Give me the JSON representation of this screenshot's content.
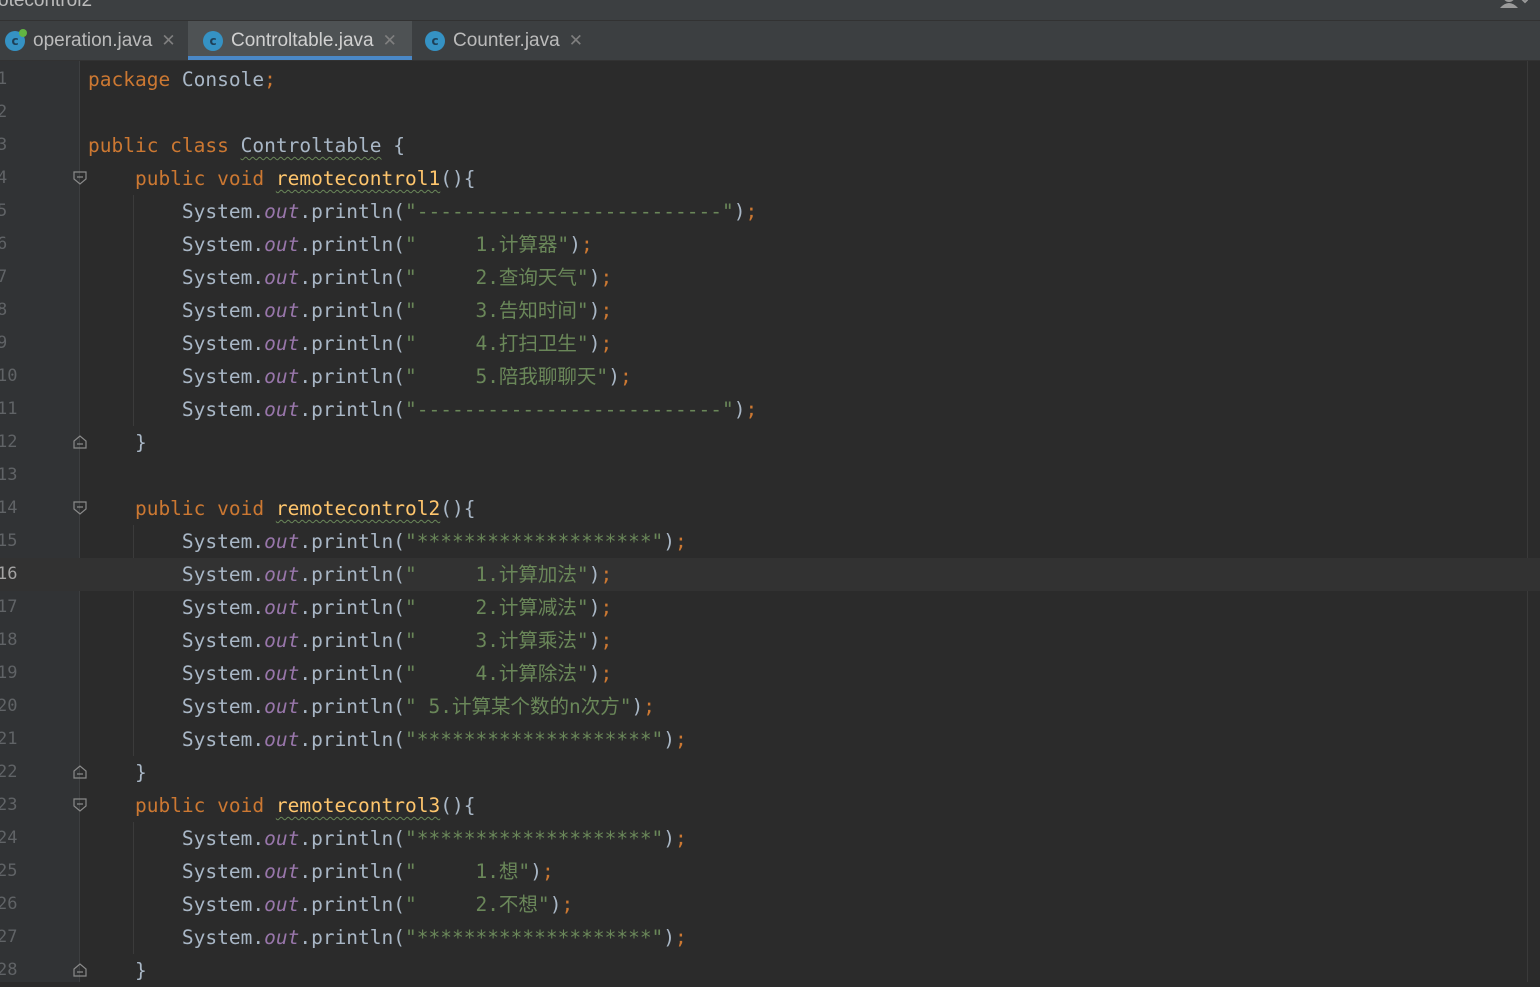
{
  "window": {
    "title": "otecontrol2"
  },
  "tabs": [
    {
      "label": "operation.java",
      "icon": "java-class-icon",
      "active": false
    },
    {
      "label": "Controltable.java",
      "icon": "java-class-icon",
      "active": true
    },
    {
      "label": "Counter.java",
      "icon": "java-class-icon",
      "active": false
    }
  ],
  "editor": {
    "current_line": 16,
    "line_numbers": [
      "1",
      "2",
      "3",
      "4",
      "5",
      "6",
      "7",
      "8",
      "9",
      "10",
      "11",
      "12",
      "13",
      "14",
      "15",
      "16",
      "17",
      "18",
      "19",
      "20",
      "21",
      "22",
      "23",
      "24",
      "25",
      "26",
      "27",
      "28"
    ],
    "lines": [
      {
        "n": "1",
        "tokens": [
          {
            "t": "package",
            "c": "kw"
          },
          {
            "t": " Console",
            "c": "pl"
          },
          {
            "t": ";",
            "c": "semi"
          }
        ]
      },
      {
        "n": "2",
        "tokens": []
      },
      {
        "n": "3",
        "tokens": [
          {
            "t": "public class ",
            "c": "kw"
          },
          {
            "t": "Controltable",
            "c": "cls"
          },
          {
            "t": " {",
            "c": "pl"
          }
        ]
      },
      {
        "n": "4",
        "fold": "open",
        "tokens": [
          {
            "t": "    public void ",
            "c": "kw"
          },
          {
            "t": "remotecontrol1",
            "c": "meth"
          },
          {
            "t": "(){",
            "c": "pl"
          }
        ]
      },
      {
        "n": "5",
        "tokens": [
          {
            "t": "        System.",
            "c": "pl"
          },
          {
            "t": "out",
            "c": "fld"
          },
          {
            "t": ".println(",
            "c": "pl"
          },
          {
            "t": "\"--------------------------\"",
            "c": "str"
          },
          {
            "t": ")",
            "c": "pl"
          },
          {
            "t": ";",
            "c": "semi"
          }
        ]
      },
      {
        "n": "6",
        "tokens": [
          {
            "t": "        System.",
            "c": "pl"
          },
          {
            "t": "out",
            "c": "fld"
          },
          {
            "t": ".println(",
            "c": "pl"
          },
          {
            "t": "\"     1.计算器\"",
            "c": "str"
          },
          {
            "t": ")",
            "c": "pl"
          },
          {
            "t": ";",
            "c": "semi"
          }
        ]
      },
      {
        "n": "7",
        "tokens": [
          {
            "t": "        System.",
            "c": "pl"
          },
          {
            "t": "out",
            "c": "fld"
          },
          {
            "t": ".println(",
            "c": "pl"
          },
          {
            "t": "\"     2.查询天气\"",
            "c": "str"
          },
          {
            "t": ")",
            "c": "pl"
          },
          {
            "t": ";",
            "c": "semi"
          }
        ]
      },
      {
        "n": "8",
        "tokens": [
          {
            "t": "        System.",
            "c": "pl"
          },
          {
            "t": "out",
            "c": "fld"
          },
          {
            "t": ".println(",
            "c": "pl"
          },
          {
            "t": "\"     3.告知时间\"",
            "c": "str"
          },
          {
            "t": ")",
            "c": "pl"
          },
          {
            "t": ";",
            "c": "semi"
          }
        ]
      },
      {
        "n": "9",
        "tokens": [
          {
            "t": "        System.",
            "c": "pl"
          },
          {
            "t": "out",
            "c": "fld"
          },
          {
            "t": ".println(",
            "c": "pl"
          },
          {
            "t": "\"     4.打扫卫生\"",
            "c": "str"
          },
          {
            "t": ")",
            "c": "pl"
          },
          {
            "t": ";",
            "c": "semi"
          }
        ]
      },
      {
        "n": "10",
        "tokens": [
          {
            "t": "        System.",
            "c": "pl"
          },
          {
            "t": "out",
            "c": "fld"
          },
          {
            "t": ".println(",
            "c": "pl"
          },
          {
            "t": "\"     5.陪我聊聊天\"",
            "c": "str"
          },
          {
            "t": ")",
            "c": "pl"
          },
          {
            "t": ";",
            "c": "semi"
          }
        ]
      },
      {
        "n": "11",
        "tokens": [
          {
            "t": "        System.",
            "c": "pl"
          },
          {
            "t": "out",
            "c": "fld"
          },
          {
            "t": ".println(",
            "c": "pl"
          },
          {
            "t": "\"--------------------------\"",
            "c": "str"
          },
          {
            "t": ")",
            "c": "pl"
          },
          {
            "t": ";",
            "c": "semi"
          }
        ]
      },
      {
        "n": "12",
        "fold": "close",
        "tokens": [
          {
            "t": "    }",
            "c": "pl"
          }
        ]
      },
      {
        "n": "13",
        "tokens": []
      },
      {
        "n": "14",
        "fold": "open",
        "tokens": [
          {
            "t": "    public void ",
            "c": "kw"
          },
          {
            "t": "remotecontrol2",
            "c": "meth"
          },
          {
            "t": "(){",
            "c": "pl"
          }
        ]
      },
      {
        "n": "15",
        "tokens": [
          {
            "t": "        System.",
            "c": "pl"
          },
          {
            "t": "out",
            "c": "fld"
          },
          {
            "t": ".println(",
            "c": "pl"
          },
          {
            "t": "\"********************\"",
            "c": "str"
          },
          {
            "t": ")",
            "c": "pl"
          },
          {
            "t": ";",
            "c": "semi"
          }
        ]
      },
      {
        "n": "16",
        "tokens": [
          {
            "t": "        System.",
            "c": "pl"
          },
          {
            "t": "out",
            "c": "fld"
          },
          {
            "t": ".println(",
            "c": "pl"
          },
          {
            "t": "\"     1.计算加法\"",
            "c": "str"
          },
          {
            "t": ")",
            "c": "pl"
          },
          {
            "t": ";",
            "c": "semi"
          }
        ]
      },
      {
        "n": "17",
        "tokens": [
          {
            "t": "        System.",
            "c": "pl"
          },
          {
            "t": "out",
            "c": "fld"
          },
          {
            "t": ".println(",
            "c": "pl"
          },
          {
            "t": "\"     2.计算减法\"",
            "c": "str"
          },
          {
            "t": ")",
            "c": "pl"
          },
          {
            "t": ";",
            "c": "semi"
          }
        ]
      },
      {
        "n": "18",
        "tokens": [
          {
            "t": "        System.",
            "c": "pl"
          },
          {
            "t": "out",
            "c": "fld"
          },
          {
            "t": ".println(",
            "c": "pl"
          },
          {
            "t": "\"     3.计算乘法\"",
            "c": "str"
          },
          {
            "t": ")",
            "c": "pl"
          },
          {
            "t": ";",
            "c": "semi"
          }
        ]
      },
      {
        "n": "19",
        "tokens": [
          {
            "t": "        System.",
            "c": "pl"
          },
          {
            "t": "out",
            "c": "fld"
          },
          {
            "t": ".println(",
            "c": "pl"
          },
          {
            "t": "\"     4.计算除法\"",
            "c": "str"
          },
          {
            "t": ")",
            "c": "pl"
          },
          {
            "t": ";",
            "c": "semi"
          }
        ]
      },
      {
        "n": "20",
        "tokens": [
          {
            "t": "        System.",
            "c": "pl"
          },
          {
            "t": "out",
            "c": "fld"
          },
          {
            "t": ".println(",
            "c": "pl"
          },
          {
            "t": "\" 5.计算某个数的n次方\"",
            "c": "str"
          },
          {
            "t": ")",
            "c": "pl"
          },
          {
            "t": ";",
            "c": "semi"
          }
        ]
      },
      {
        "n": "21",
        "tokens": [
          {
            "t": "        System.",
            "c": "pl"
          },
          {
            "t": "out",
            "c": "fld"
          },
          {
            "t": ".println(",
            "c": "pl"
          },
          {
            "t": "\"********************\"",
            "c": "str"
          },
          {
            "t": ")",
            "c": "pl"
          },
          {
            "t": ";",
            "c": "semi"
          }
        ]
      },
      {
        "n": "22",
        "fold": "close",
        "tokens": [
          {
            "t": "    }",
            "c": "pl"
          }
        ]
      },
      {
        "n": "23",
        "fold": "open",
        "tokens": [
          {
            "t": "    public void ",
            "c": "kw"
          },
          {
            "t": "remotecontrol3",
            "c": "meth"
          },
          {
            "t": "(){",
            "c": "pl"
          }
        ]
      },
      {
        "n": "24",
        "tokens": [
          {
            "t": "        System.",
            "c": "pl"
          },
          {
            "t": "out",
            "c": "fld"
          },
          {
            "t": ".println(",
            "c": "pl"
          },
          {
            "t": "\"********************\"",
            "c": "str"
          },
          {
            "t": ")",
            "c": "pl"
          },
          {
            "t": ";",
            "c": "semi"
          }
        ]
      },
      {
        "n": "25",
        "tokens": [
          {
            "t": "        System.",
            "c": "pl"
          },
          {
            "t": "out",
            "c": "fld"
          },
          {
            "t": ".println(",
            "c": "pl"
          },
          {
            "t": "\"     1.想\"",
            "c": "str"
          },
          {
            "t": ")",
            "c": "pl"
          },
          {
            "t": ";",
            "c": "semi"
          }
        ]
      },
      {
        "n": "26",
        "tokens": [
          {
            "t": "        System.",
            "c": "pl"
          },
          {
            "t": "out",
            "c": "fld"
          },
          {
            "t": ".println(",
            "c": "pl"
          },
          {
            "t": "\"     2.不想\"",
            "c": "str"
          },
          {
            "t": ")",
            "c": "pl"
          },
          {
            "t": ";",
            "c": "semi"
          }
        ]
      },
      {
        "n": "27",
        "tokens": [
          {
            "t": "        System.",
            "c": "pl"
          },
          {
            "t": "out",
            "c": "fld"
          },
          {
            "t": ".println(",
            "c": "pl"
          },
          {
            "t": "\"********************\"",
            "c": "str"
          },
          {
            "t": ")",
            "c": "pl"
          },
          {
            "t": ";",
            "c": "semi"
          }
        ]
      },
      {
        "n": "28",
        "fold": "close",
        "tokens": [
          {
            "t": "    }",
            "c": "pl"
          }
        ]
      }
    ]
  },
  "colors": {
    "background": "#2b2b2b",
    "keyword": "#cc7832",
    "string": "#6a8759",
    "field": "#9876aa",
    "method_decl": "#ffc66d",
    "plain": "#a9b7c6",
    "tab_accent": "#4a88c7"
  }
}
